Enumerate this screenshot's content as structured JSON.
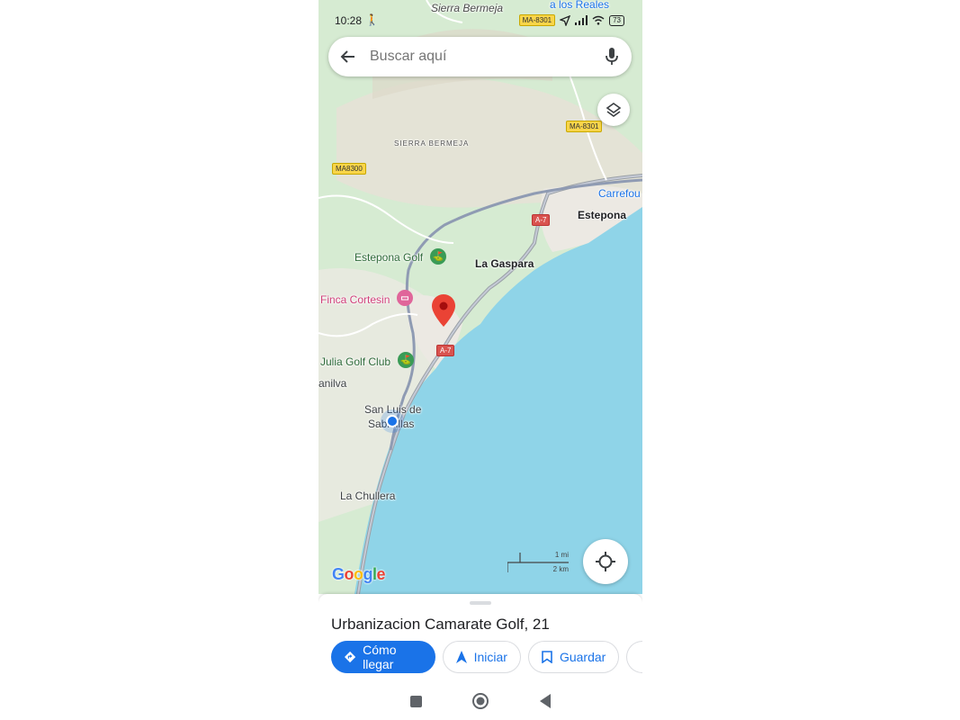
{
  "status_bar": {
    "time": "10:28",
    "activity_icon": "walking-person-icon",
    "battery": "73",
    "road_shield": "MA-8301"
  },
  "search": {
    "placeholder": "Buscar aquí",
    "back_icon": "arrow-back-icon",
    "mic_icon": "microphone-icon"
  },
  "map": {
    "labels": {
      "sierra_bermeja_top": "Sierra Bermeja",
      "a_los_reales": "a los Reales",
      "sierra_bermeja_caps": "SIERRA BERMEJA",
      "carrefour": "Carrefou",
      "estepona": "Estepona",
      "estepona_golf": "Estepona Golf",
      "la_gaspara": "La Gaspara",
      "finca_cortesin": "Finca Cortesin",
      "julia_golf_club": "Julia Golf Club",
      "manilva": "anilva",
      "san_luis_1": "San Luis de",
      "san_luis_2": "Sabinillas",
      "la_chullera": "La Chullera"
    },
    "road_shields": {
      "ma8301": "MA-8301",
      "ma8300": "MA8300",
      "a7_north": "A-7",
      "a7_south": "A-7"
    },
    "scale": {
      "miles": "1 mi",
      "km": "2 km"
    },
    "logo": "Google",
    "colors": {
      "water": "#8fd4e8",
      "land": "#d6ebd2",
      "urban": "#ece9e3",
      "pin": "#ea4335",
      "location_dot": "#1a73e8"
    }
  },
  "sheet": {
    "title": "Urbanizacion Camarate Golf, 21",
    "actions": [
      {
        "label": "Cómo llegar",
        "icon": "directions-icon"
      },
      {
        "label": "Iniciar",
        "icon": "navigation-arrow-icon"
      },
      {
        "label": "Guardar",
        "icon": "bookmark-icon"
      }
    ]
  },
  "navbar": {
    "recents_icon": "square-icon",
    "home_icon": "circle-home-icon",
    "back_icon": "triangle-back-icon"
  }
}
